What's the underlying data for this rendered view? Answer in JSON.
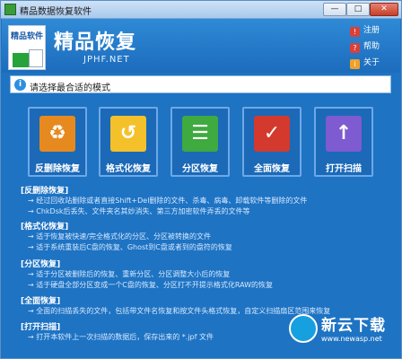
{
  "window": {
    "title": "精品数据恢复软件",
    "min_label": "—",
    "max_label": "□",
    "close_label": "✕"
  },
  "header": {
    "brand": "精品恢复",
    "subtitle": "JPHF.NET",
    "logo_text": "精品软件",
    "side": [
      {
        "icon": "register-icon",
        "color": "#d9403a",
        "glyph": "!",
        "label": "注册"
      },
      {
        "icon": "help-icon",
        "color": "#d9403a",
        "glyph": "?",
        "label": "帮助"
      },
      {
        "icon": "about-icon",
        "color": "#f0a12a",
        "glyph": "i",
        "label": "关于"
      }
    ]
  },
  "banner": {
    "text": "请选择最合适的模式"
  },
  "modes": [
    {
      "label": "反删除恢复",
      "color": "#e68a1f",
      "glyph": "♻",
      "name": "mode-undelete"
    },
    {
      "label": "格式化恢复",
      "color": "#f4c12a",
      "glyph": "↺",
      "name": "mode-format"
    },
    {
      "label": "分区恢复",
      "color": "#3faa3f",
      "glyph": "☰",
      "name": "mode-partition"
    },
    {
      "label": "全面恢复",
      "color": "#d33a2d",
      "glyph": "✓",
      "name": "mode-full"
    },
    {
      "label": "打开扫描",
      "color": "#7e5bd0",
      "glyph": "↑",
      "name": "mode-open-scan"
    }
  ],
  "sections": [
    {
      "title": "[反删除恢复]",
      "lines": [
        "→ 经过回收站删除或者直接Shift+Del删除的文件、杀毒、病毒、卸载软件等删除的文件",
        "→ ChkDsk后丢失、文件夹名其妙消失、第三方加密软件弄丢的文件等"
      ]
    },
    {
      "title": "[格式化恢复]",
      "lines": [
        "→ 适于恢复被快速/完全格式化的分区、分区被转换的文件",
        "→ 适于系统重装后C盘的恢复、Ghost到C盘或者到的盘符的恢复"
      ]
    },
    {
      "title": "[分区恢复]",
      "lines": [
        "→ 适于分区被删除后的恢复、重新分区、分区调整大小后的恢复",
        "→ 适于硬盘全部分区变成一个C盘的恢复、分区打不开提示格式化RAW的恢复"
      ]
    },
    {
      "title": "[全面恢复]",
      "lines": [
        "→ 全面的扫描丢失的文件，包括带文件名恢复和按文件头格式恢复，自定义扫描扇区范围来恢复"
      ]
    },
    {
      "title": "[打开扫描]",
      "lines": [
        "→ 打开本软件上一次扫描的数据后，保存出来的 *.jpf 文件"
      ]
    }
  ],
  "watermark": {
    "text": "新云下载",
    "url": "www.newasp.net"
  }
}
